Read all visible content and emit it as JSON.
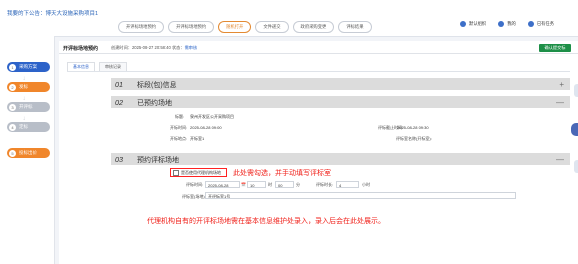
{
  "window": {
    "title": "我要的下公告：博天大设施采购项目1"
  },
  "tabs": [
    {
      "label": "开评标场地预约"
    },
    {
      "label": "开评标场地预约"
    },
    {
      "label": "随机打开"
    },
    {
      "label": "文件递交"
    },
    {
      "label": "政府采购变更"
    },
    {
      "label": "评标结果"
    }
  ],
  "top_actions": [
    {
      "label": "默认组织"
    },
    {
      "label": "我的"
    },
    {
      "label": "已有任务"
    }
  ],
  "sidebar": {
    "steps": [
      {
        "num": "1",
        "label": "采购方案"
      },
      {
        "num": "2",
        "label": "发标"
      },
      {
        "num": "3",
        "label": "开评标"
      },
      {
        "num": "4",
        "label": "定标"
      },
      {
        "num": "5",
        "label": "投标出价"
      }
    ]
  },
  "main": {
    "title": "开评标场地预约",
    "meta_prefix": "创建时间：2025-08-27 20:58:40 状态：",
    "meta_link": "需审核",
    "confirm_label": "确认提交标",
    "subtabs": [
      {
        "label": "基本信息"
      },
      {
        "label": "审核记录"
      }
    ]
  },
  "sections": [
    {
      "num": "01",
      "title": "标段(包)信息",
      "toggle": "+"
    },
    {
      "num": "02",
      "title": "已预约场地",
      "toggle": "—"
    },
    {
      "num": "03",
      "title": "预约评标场地",
      "toggle": "—"
    }
  ],
  "reserved": {
    "label_project": "标题:",
    "project_value": "泉州开发区公开采购项目",
    "label_open_time": "开标时间:",
    "open_time_value": "2025-08-28 09:00",
    "label_end_time": "评标截止时间:",
    "end_time_value": "2025-08-28 09:30",
    "label_place": "开标地点:",
    "place_value": "开标室1",
    "label_review_room": "评标室名称(开标室):",
    "review_room_value": ""
  },
  "booking": {
    "checkbox_label": "是否使用代理机构场地",
    "hint_check": "此处需勾选，并手动填写评标室",
    "label_time": "评标时间:",
    "date_value": "2025-08-28",
    "hour_value": "10",
    "minute_value": "00",
    "duration_label": "评标时长:",
    "duration_value": "4",
    "unit_hour": "时",
    "unit_minute": "分",
    "unit_hours": "小时",
    "label_room": "评标室(场地):",
    "room_value": "开评标室1号"
  },
  "bottom_note": "代理机构自有的开评标场地需在基本信息维护处录入，录入后会在此处展示。",
  "colors": {
    "primary": "#2d63c9",
    "orange": "#f0862b",
    "green": "#1d8f47",
    "red": "#f0221b"
  }
}
